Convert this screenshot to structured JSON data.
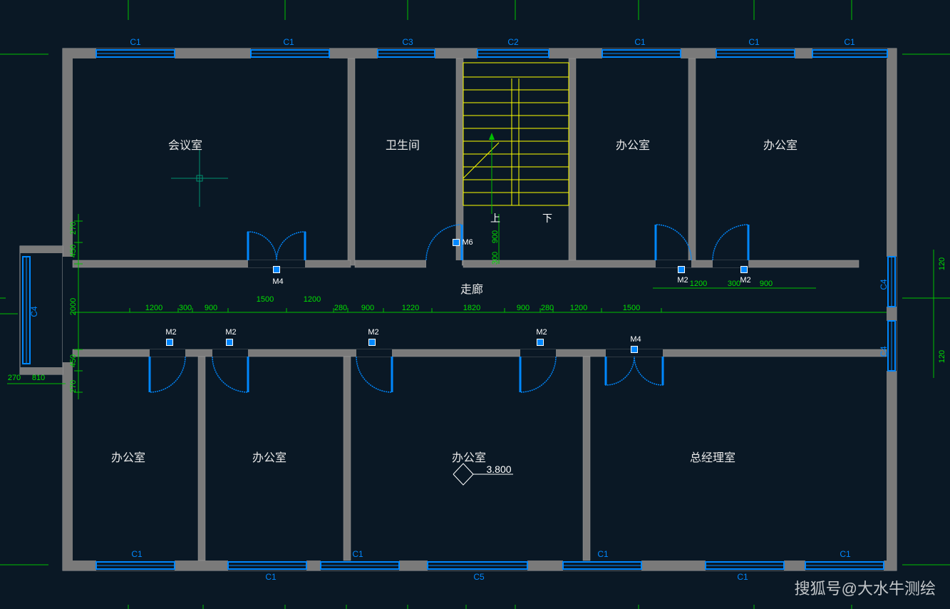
{
  "rooms": {
    "meeting": "会议室",
    "toilet": "卫生间",
    "office1": "办公室",
    "office2": "办公室",
    "office3": "办公室",
    "office4": "办公室",
    "office5": "办公室",
    "manager": "总经理室",
    "corridor": "走廊"
  },
  "windows": {
    "c1": "C1",
    "c2": "C2",
    "c3": "C3",
    "c4": "C4",
    "c5": "C5"
  },
  "doors": {
    "m2": "M2",
    "m4": "M4",
    "m6": "M6"
  },
  "stairs": {
    "up": "上",
    "down": "下"
  },
  "elevation": "3.800",
  "dimensions": {
    "d1500a": "1500",
    "d1200a": "1200",
    "d280a": "280",
    "d900a": "900",
    "d1220": "1220",
    "d1820": "1820",
    "d900b": "900",
    "d280b": "280",
    "d1200b": "1200",
    "d1500b": "1500",
    "d1200c": "1200",
    "d300c": "300",
    "d900c": "900",
    "d1200d": "1200",
    "d300d": "300",
    "d900d": "900",
    "d270a": "270",
    "d450a": "450",
    "d2000": "2000",
    "d450b": "450",
    "d270b": "270",
    "d270c": "270",
    "d810": "810",
    "d900e": "900",
    "d300e": "300",
    "d120a": "120",
    "d120b": "120"
  },
  "watermark": "搜狐号@大水牛测绘",
  "colors": {
    "bg": "#0a1825",
    "wall": "#9e9e9e",
    "window": "#0088ff",
    "dim": "#00e000",
    "stair": "#ffff00"
  }
}
